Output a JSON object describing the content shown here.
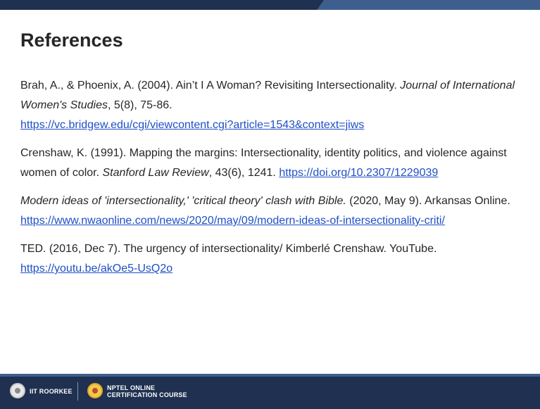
{
  "slide": {
    "title": "References"
  },
  "references": [
    {
      "before": "Brah, A., & Phoenix, A. (2004). Ain’t I A Woman? Revisiting Intersectionality. ",
      "italic": "Journal of International Women's Studies",
      "after": ", 5(8), 75-86.",
      "link": "https://vc.bridgew.edu/cgi/viewcontent.cgi?article=1543&context=jiws"
    },
    {
      "before": "Crenshaw, K. (1991). Mapping the margins: Intersectionality, identity politics, and violence against women of color. ",
      "italic": "Stanford Law Review",
      "after": ", 43(6), 1241. ",
      "link": "https://doi.org/10.2307/1229039"
    },
    {
      "before": "",
      "italic": "Modern ideas of 'intersectionality,' 'critical theory' clash with Bible.",
      "after": " (2020, May 9). Arkansas Online.",
      "link": "https://www.nwaonline.com/news/2020/may/09/modern-ideas-of-intersectionality-criti/"
    },
    {
      "before": "TED. (2016, Dec 7). The urgency of intersectionality/ Kimberlé Crenshaw. YouTube.",
      "italic": "",
      "after": "",
      "link": "https://youtu.be/akOe5-UsQ2o"
    }
  ],
  "footer": {
    "institute": "IIT ROORKEE",
    "course_line1": "NPTEL ONLINE",
    "course_line2": "CERTIFICATION COURSE",
    "logo_iit_icon": "iit-roorkee-logo-icon",
    "logo_nptel_icon": "nptel-logo-icon"
  },
  "colors": {
    "bar": "#1f3050",
    "accent": "#3e5f8e",
    "link": "#1f4fc7",
    "text": "#262626"
  }
}
